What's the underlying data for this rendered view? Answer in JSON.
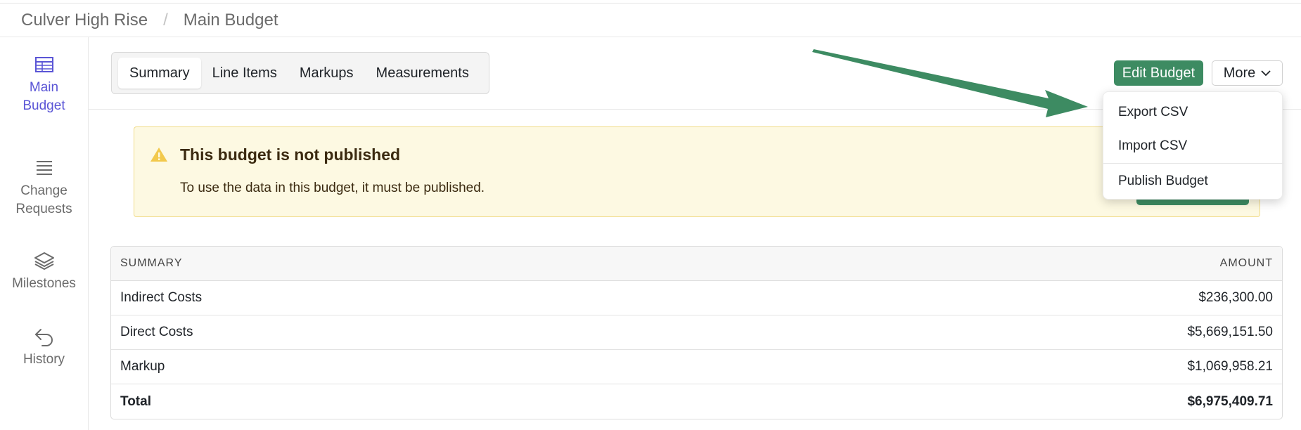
{
  "breadcrumb": {
    "project": "Culver High Rise",
    "separator": "/",
    "page": "Main Budget"
  },
  "sidebar": {
    "items": [
      {
        "label_line1": "Main",
        "label_line2": "Budget",
        "icon": "table-icon",
        "active": true
      },
      {
        "label_line1": "Change",
        "label_line2": "Requests",
        "icon": "list-icon",
        "active": false
      },
      {
        "label_line1": "Milestones",
        "label_line2": "",
        "icon": "layers-icon",
        "active": false
      },
      {
        "label_line1": "History",
        "label_line2": "",
        "icon": "undo-icon",
        "active": false
      }
    ]
  },
  "tabs": [
    {
      "label": "Summary",
      "active": true
    },
    {
      "label": "Line Items",
      "active": false
    },
    {
      "label": "Markups",
      "active": false
    },
    {
      "label": "Measurements",
      "active": false
    }
  ],
  "toolbar": {
    "edit_label": "Edit Budget",
    "more_label": "More"
  },
  "dropdown": {
    "items": [
      "Export CSV",
      "Import CSV",
      "Publish Budget"
    ]
  },
  "alert": {
    "title": "This budget is not published",
    "message": "To use the data in this budget, it must be published."
  },
  "summary_table": {
    "headers": {
      "left": "SUMMARY",
      "right": "AMOUNT"
    },
    "rows": [
      {
        "label": "Indirect Costs",
        "amount": "$236,300.00"
      },
      {
        "label": "Direct Costs",
        "amount": "$5,669,151.50"
      },
      {
        "label": "Markup",
        "amount": "$1,069,958.21"
      },
      {
        "label": "Total",
        "amount": "$6,975,409.71"
      }
    ]
  },
  "colors": {
    "accent": "#5a55d6",
    "primary_button": "#3d8b62",
    "alert_bg": "#fdf9e2",
    "annotation_arrow": "#3d8b62"
  }
}
